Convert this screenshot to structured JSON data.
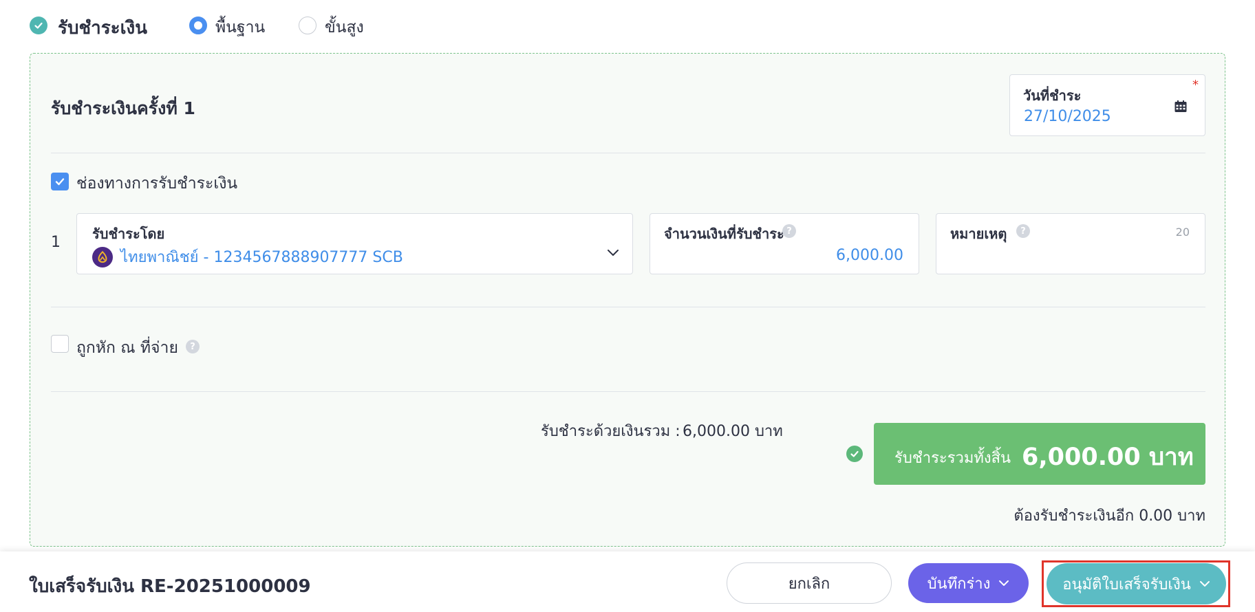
{
  "payment_toggle": {
    "label": "รับชำระเงิน"
  },
  "mode_options": {
    "basic": "พื้นฐาน",
    "advanced": "ขั้นสูง",
    "selected": "basic"
  },
  "installment": {
    "title": "รับชำระเงินครั้งที่ 1",
    "date_label": "วันที่ชำระ",
    "date_value": "27/10/2025",
    "required_mark": "*"
  },
  "channel": {
    "checkbox_label": "ช่องทางการรับชำระเงิน",
    "row_number": "1",
    "method_label": "รับชำระโดย",
    "method_value": "ไทยพาณิชย์ - 1234567888907777 SCB",
    "amount_label": "จำนวนเงินที่รับชำระ",
    "amount_value": "6,000.00",
    "note_label": "หมายเหตุ",
    "note_counter": "20",
    "help_glyph": "?"
  },
  "withholding": {
    "label": "ถูกหัก ณ ที่จ่าย"
  },
  "summary": {
    "subtotal_label": "รับชำระด้วยเงินรวม :",
    "subtotal_value": "6,000.00 บาท",
    "total_label": "รับชำระรวมทั้งสิ้น",
    "total_value": "6,000.00 บาท",
    "remaining_text": "ต้องรับชำระเงินอีก 0.00 บาท"
  },
  "footer": {
    "doc_title": "ใบเสร็จรับเงิน RE-20251000009",
    "cancel_label": "ยกเลิก",
    "draft_label": "บันทึกร่าง",
    "approve_label": "อนุมัติใบเสร็จรับเงิน"
  },
  "colors": {
    "accent_blue": "#4a8ff0",
    "teal": "#4fb6b1",
    "total_green": "#6bbf73",
    "draft_purple": "#6b63e8",
    "approve_teal": "#5cbcc4",
    "highlight_red": "#e0342a"
  },
  "icons": {
    "payment_check": "check-circle-icon",
    "date": "calendar-icon",
    "dropdown": "chevron-down-icon",
    "bank": "scb-bank-logo-icon"
  }
}
